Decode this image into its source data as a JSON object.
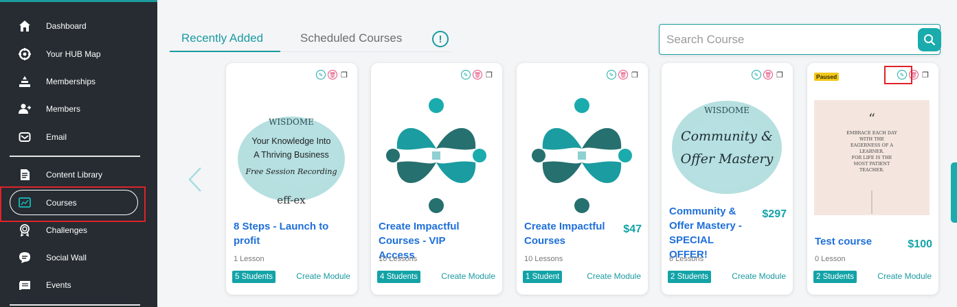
{
  "sidebar": {
    "items": [
      {
        "label": "Dashboard",
        "icon": "home-icon"
      },
      {
        "label": "Your HUB Map",
        "icon": "hub-map-icon"
      },
      {
        "label": "Memberships",
        "icon": "memberships-icon"
      },
      {
        "label": "Members",
        "icon": "members-icon"
      },
      {
        "label": "Email",
        "icon": "email-icon"
      },
      {
        "label": "Content Library",
        "icon": "content-library-icon"
      },
      {
        "label": "Courses",
        "icon": "courses-icon"
      },
      {
        "label": "Challenges",
        "icon": "challenges-icon"
      },
      {
        "label": "Social Wall",
        "icon": "social-wall-icon"
      },
      {
        "label": "Events",
        "icon": "events-icon"
      }
    ],
    "active": "Courses"
  },
  "tabs": [
    {
      "label": "Recently Added",
      "active": true
    },
    {
      "label": "Scheduled Courses",
      "active": false
    }
  ],
  "info_icon": "!",
  "search": {
    "placeholder": "Search Course",
    "value": ""
  },
  "colors": {
    "accent": "#1aabad",
    "title_blue": "#1e6fd9",
    "sidebar": "#262c32",
    "highlight_red": "#e0222a"
  },
  "cards": [
    {
      "title": "8 Steps - Launch to profit",
      "price": "",
      "lessons": "1 Lesson",
      "students": "5 Students",
      "create_module": "Create Module",
      "status": "",
      "thumb": {
        "brand": "WISDOME",
        "lines": [
          "Your Knowledge Into",
          "A Thriving Business"
        ],
        "script": "Free Session Recording",
        "footer": "eff-ex"
      }
    },
    {
      "title": "Create Impactful Courses - VIP Access",
      "price": "",
      "lessons": "10 Lessons",
      "students": "4 Students",
      "create_module": "Create Module",
      "status": ""
    },
    {
      "title": "Create Impactful Courses",
      "price": "$47",
      "lessons": "10 Lessons",
      "students": "1 Student",
      "create_module": "Create Module",
      "status": ""
    },
    {
      "title": "Community & Offer Mastery - SPECIAL OFFER!",
      "price": "$297",
      "lessons": "6 Lessons",
      "students": "2 Students",
      "create_module": "Create Module",
      "status": "",
      "thumb": {
        "brand": "WISDOME",
        "script1": "Community &",
        "script2": "Offer Mastery"
      }
    },
    {
      "title": "Test course",
      "price": "$100",
      "lessons": "0 Lesson",
      "students": "2 Students",
      "create_module": "Create Module",
      "status": "Paused",
      "thumb": {
        "quote_lines": [
          "EMBRACE EACH DAY",
          "WITH THE",
          "EAGERNESS OF A",
          "LEARNER.",
          "FOR LIFE IS THE",
          "MOST PATIENT",
          "TEACHER."
        ]
      }
    }
  ]
}
